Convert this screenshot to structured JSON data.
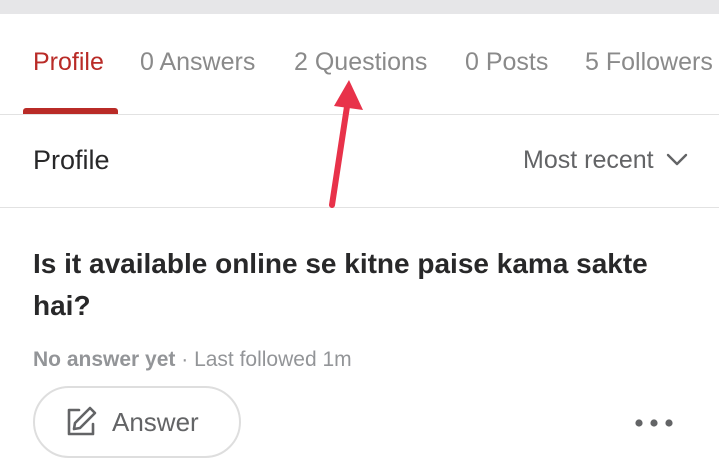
{
  "tabs": [
    {
      "label": "Profile",
      "active": true
    },
    {
      "label": "0 Answers",
      "active": false
    },
    {
      "label": "2 Questions",
      "active": false
    },
    {
      "label": "0 Posts",
      "active": false
    },
    {
      "label": "5 Followers",
      "active": false
    }
  ],
  "section": {
    "title": "Profile",
    "sort_label": "Most recent",
    "sort_icon": "chevron-down-icon"
  },
  "question": {
    "title": "Is it available online se kitne paise kama sakte hai?",
    "status": "No answer yet",
    "separator": " · ",
    "followed": "Last followed 1m"
  },
  "actions": {
    "answer_label": "Answer",
    "answer_icon": "pencil-icon",
    "more_icon": "more-dots-icon"
  },
  "colors": {
    "accent": "#b92b27",
    "annotation_arrow": "#e8324a",
    "muted_text": "#8a8a8a",
    "divider": "#e2e2e2"
  }
}
